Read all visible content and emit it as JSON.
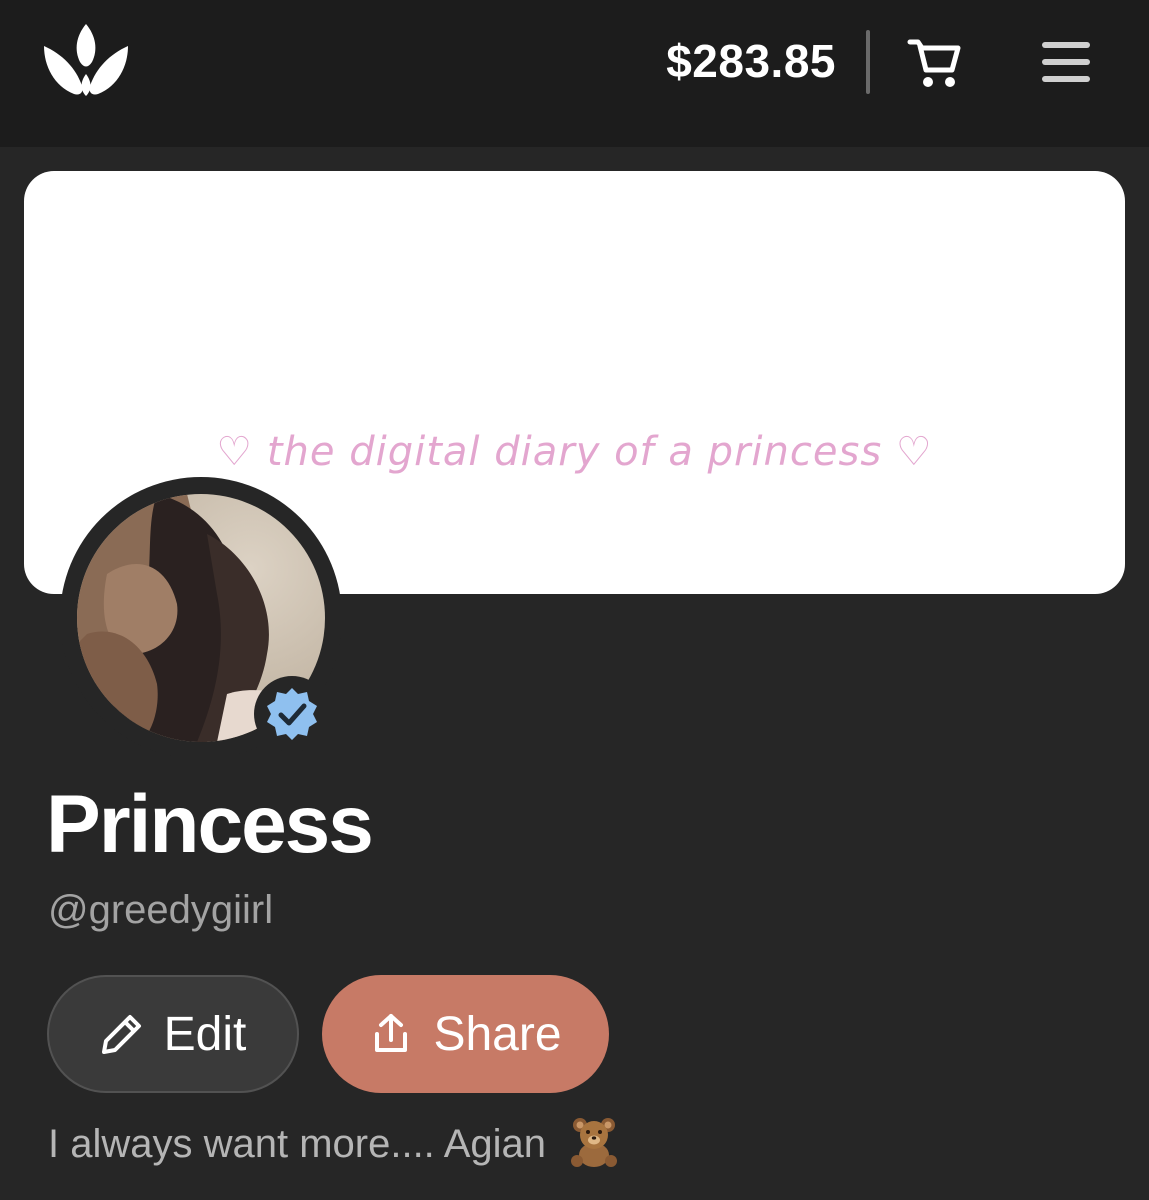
{
  "header": {
    "balance": "$283.85",
    "logo_icon": "crown-logo-icon",
    "cart_icon": "cart-icon",
    "menu_icon": "hamburger-menu-icon"
  },
  "profile": {
    "banner_text": "♡ the digital diary of a princess ♡",
    "display_name": "Princess",
    "handle": "@greedygiirl",
    "verified": true,
    "bio": "I always want more.... Agian",
    "bio_emoji_icon": "teddy-bear-icon"
  },
  "actions": {
    "edit_label": "Edit",
    "share_label": "Share"
  },
  "colors": {
    "background": "#262626",
    "topbar": "#1c1c1c",
    "share_button": "#c77a66",
    "edit_button": "#3a3a3a",
    "banner_text": "#e3a6cf",
    "verified_badge": "#8fc0ef"
  }
}
